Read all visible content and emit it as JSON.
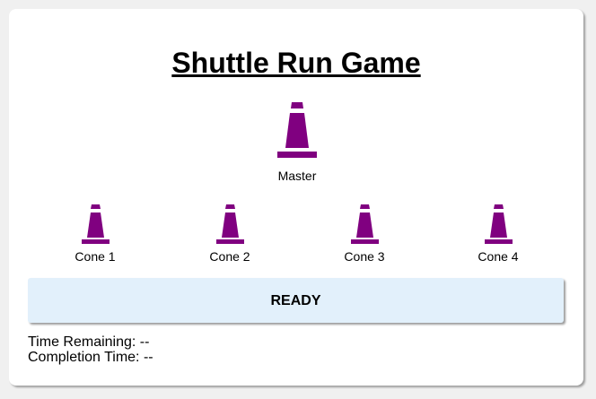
{
  "title": "Shuttle Run Game",
  "cone_color": "#800080",
  "button_bg": "#e2f0fb",
  "master": {
    "label": "Master",
    "icon": "traffic-cone-icon"
  },
  "cones": [
    {
      "label": "Cone 1",
      "icon": "traffic-cone-icon"
    },
    {
      "label": "Cone 2",
      "icon": "traffic-cone-icon"
    },
    {
      "label": "Cone 3",
      "icon": "traffic-cone-icon"
    },
    {
      "label": "Cone 4",
      "icon": "traffic-cone-icon"
    }
  ],
  "ready_button": {
    "label": "READY"
  },
  "status": {
    "time_remaining_label": "Time Remaining: --",
    "completion_time_label": "Completion Time: --"
  }
}
